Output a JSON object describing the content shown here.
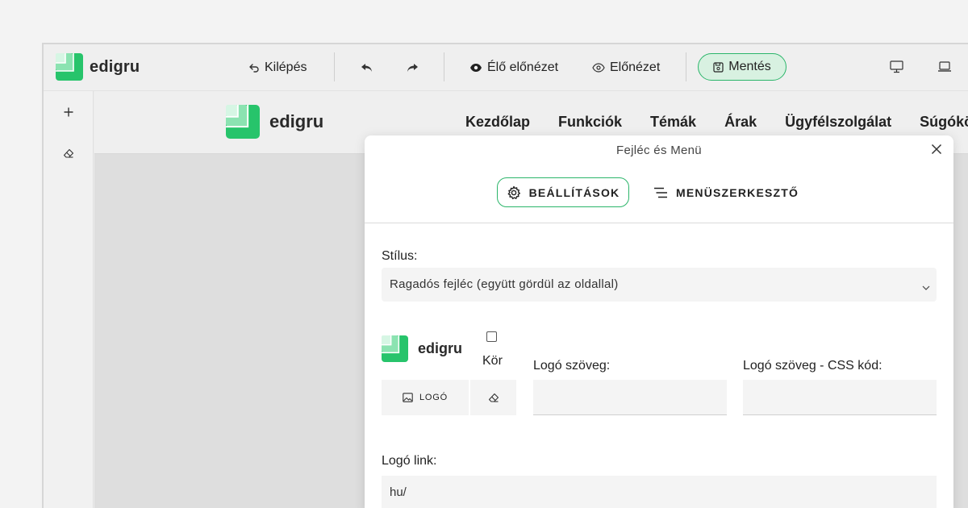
{
  "app": {
    "brand": "edigru"
  },
  "toolbar": {
    "exit_label": "Kilépés",
    "live_preview_label": "Élő előnézet",
    "preview_label": "Előnézet",
    "save_label": "Mentés"
  },
  "site": {
    "brand": "edigru",
    "nav": [
      "Kezdőlap",
      "Funkciók",
      "Témák",
      "Árak",
      "Ügyfélszolgálat",
      "Súgóközp"
    ]
  },
  "modal": {
    "title": "Fejléc és Menü",
    "tabs": [
      {
        "label": "BEÁLLÍTÁSOK",
        "active": true
      },
      {
        "label": "MENÜSZERKESZTŐ",
        "active": false
      }
    ],
    "style_label": "Stílus:",
    "style_value": "Ragadós fejléc (együtt gördül az oldallal)",
    "logo_preview_text": "edigru",
    "circle_label": "Kör",
    "circle_checked": false,
    "logo_button_label": "LOGÓ",
    "logo_text_label": "Logó szöveg:",
    "logo_text_value": "",
    "logo_css_label": "Logó szöveg - CSS kód:",
    "logo_css_value": "",
    "logo_link_label": "Logó link:",
    "logo_link_value": "hu/"
  },
  "colors": {
    "accent": "#2bb56a",
    "accent_light": "#d8f1e1",
    "logo_green": "#2ecc71"
  }
}
